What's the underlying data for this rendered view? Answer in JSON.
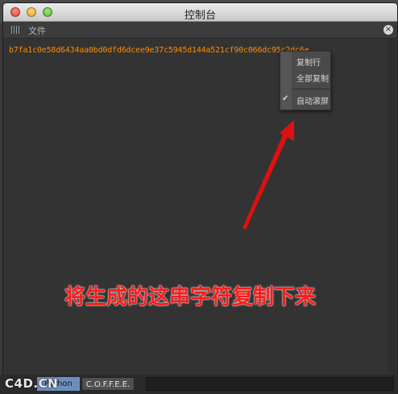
{
  "window": {
    "title": "控制台"
  },
  "menubar": {
    "file_label": "文件",
    "close_glyph": "×"
  },
  "console": {
    "hash_text": "b7fa1c0e58d6434aa0bd0dfd6dcee9e37c5945d144a521cf90c066dc95c2dc6e"
  },
  "context_menu": {
    "items": [
      {
        "label": "复制行"
      },
      {
        "label": "全部复制"
      },
      {
        "label": "自动滚屏",
        "checked": true,
        "check_glyph": "✔"
      }
    ]
  },
  "annotation": {
    "text": "将生成的这串字符复制下来",
    "color": "#ff1a1a"
  },
  "bottom_tabs": [
    {
      "label": "Python"
    },
    {
      "label": "C.O.F.F.E.E."
    }
  ],
  "watermark": {
    "text": "C4D.CN"
  },
  "colors": {
    "hash_text": "#ff8a00",
    "arrow": "#e01010",
    "python_tab": "#6d8dbf"
  }
}
